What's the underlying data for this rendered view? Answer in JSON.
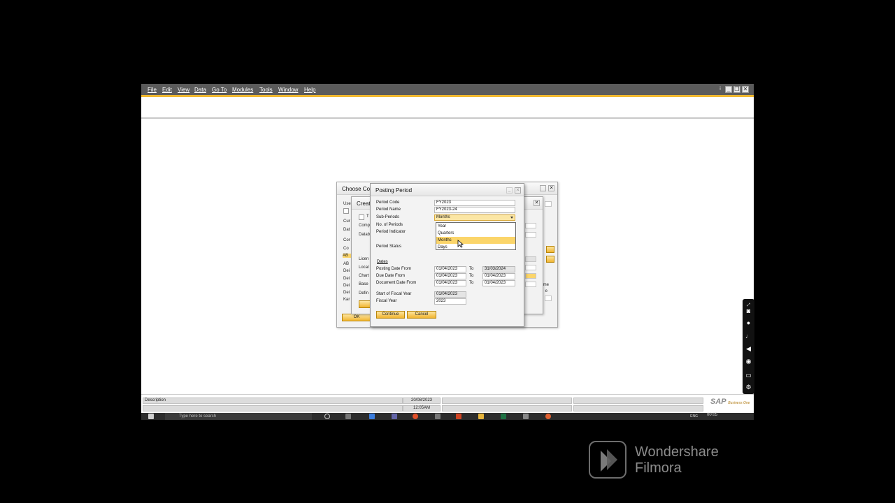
{
  "menubar": {
    "items": [
      "File",
      "Edit",
      "View",
      "Data",
      "Go To",
      "Modules",
      "Tools",
      "Window",
      "Help"
    ]
  },
  "choose_company_dialog": {
    "title": "Choose Com",
    "labels": [
      "Use",
      "Cur",
      "Dat",
      "Cor",
      "Co",
      "AB",
      "AB",
      "Dei",
      "Dei",
      "Dei",
      "Dei",
      "Kar"
    ],
    "ok_label": "OK"
  },
  "create_dialog": {
    "title": "Create",
    "labels": [
      "T",
      "Comp",
      "Datab",
      "Licen",
      "Local",
      "Chart",
      "Base",
      "Defin"
    ],
    "right_labels": [
      "me",
      "e"
    ]
  },
  "posting_period": {
    "title": "Posting Period",
    "period_code_label": "Period Code",
    "period_code": "FY2023",
    "period_name_label": "Period Name",
    "period_name": "FY2023-24",
    "sub_periods_label": "Sub-Periods",
    "sub_periods": "Months",
    "sub_period_options": [
      "Year",
      "Quarters",
      "Months",
      "Days"
    ],
    "highlighted_option": "Months",
    "no_periods_label": "No. of Periods",
    "period_indicator_label": "Period Indicator",
    "period_status_label": "Period Status",
    "dates_label": "Dates",
    "posting_from_label": "Posting Date From",
    "posting_from": "01/04/2023",
    "posting_to": "31/03/2024",
    "due_from_label": "Due Date From",
    "due_from": "01/04/2023",
    "due_to": "01/04/2023",
    "doc_from_label": "Document Date From",
    "doc_from": "01/04/2023",
    "doc_to": "01/04/2023",
    "to_label": "To",
    "start_fy_label": "Start of Fiscal Year",
    "start_fy": "01/04/2023",
    "fiscal_year_label": "Fiscal Year",
    "fiscal_year": "2023",
    "continue_label": "Continue",
    "cancel_label": "Cancel"
  },
  "statusbar": {
    "description_label": "Description",
    "date": "20/08/2023",
    "time": "12:05AM",
    "logo_text": "SAP",
    "logo_sub": "Business One"
  },
  "taskbar": {
    "search_placeholder": "Type here to search",
    "lang": "ENG",
    "clock": "00:05"
  },
  "watermark": {
    "line1": "Wondershare",
    "line2": "Filmora"
  },
  "colors": {
    "menubar": "#5b5b5b",
    "accent": "#f0b830",
    "highlight": "#fbd56a"
  }
}
